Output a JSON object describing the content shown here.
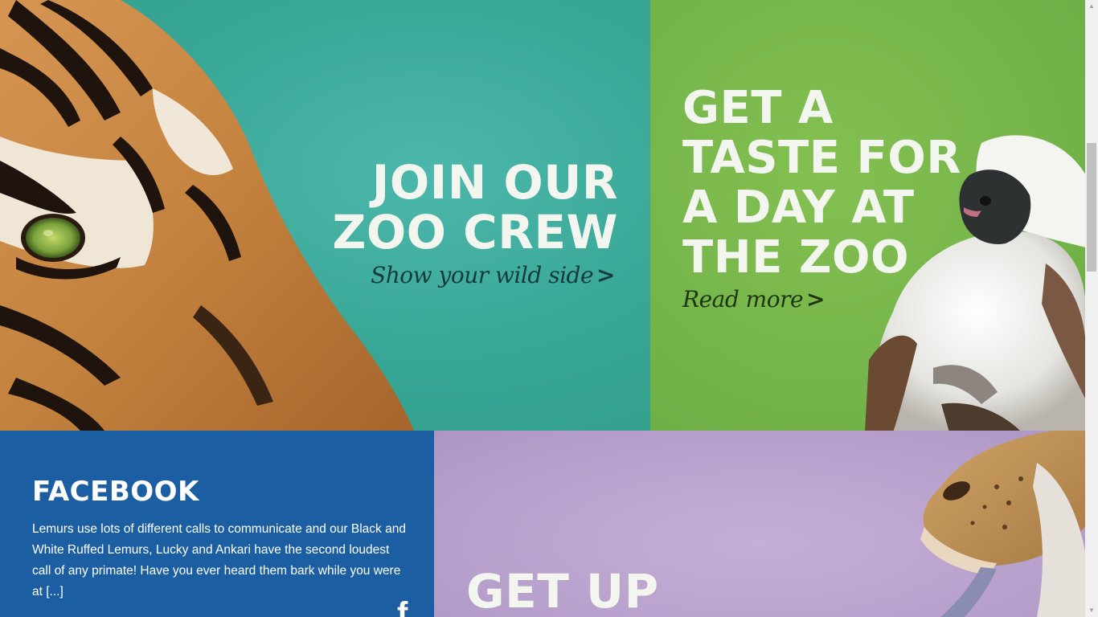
{
  "tiles": {
    "crew": {
      "title": "JOIN OUR ZOO CREW",
      "link": "Show your wild side",
      "color": "#3aa897"
    },
    "taste": {
      "title": "GET A TASTE FOR A DAY AT THE ZOO",
      "link": "Read more",
      "color": "#74b44a"
    },
    "facebook": {
      "title": "FACEBOOK",
      "text": "Lemurs use lots of different calls to communicate and our Black and White Ruffed Lemurs, Lucky and Ankari have the second loudest call of any primate! Have you ever heard them bark while you were at [...]",
      "icon": "f",
      "color": "#1c5ea2"
    },
    "getup": {
      "title": "GET UP",
      "color": "#b8a1cc"
    }
  },
  "icons": {
    "facebook": "facebook-icon",
    "chevron": "chevron-right-icon"
  },
  "chevron_glyph": ">"
}
